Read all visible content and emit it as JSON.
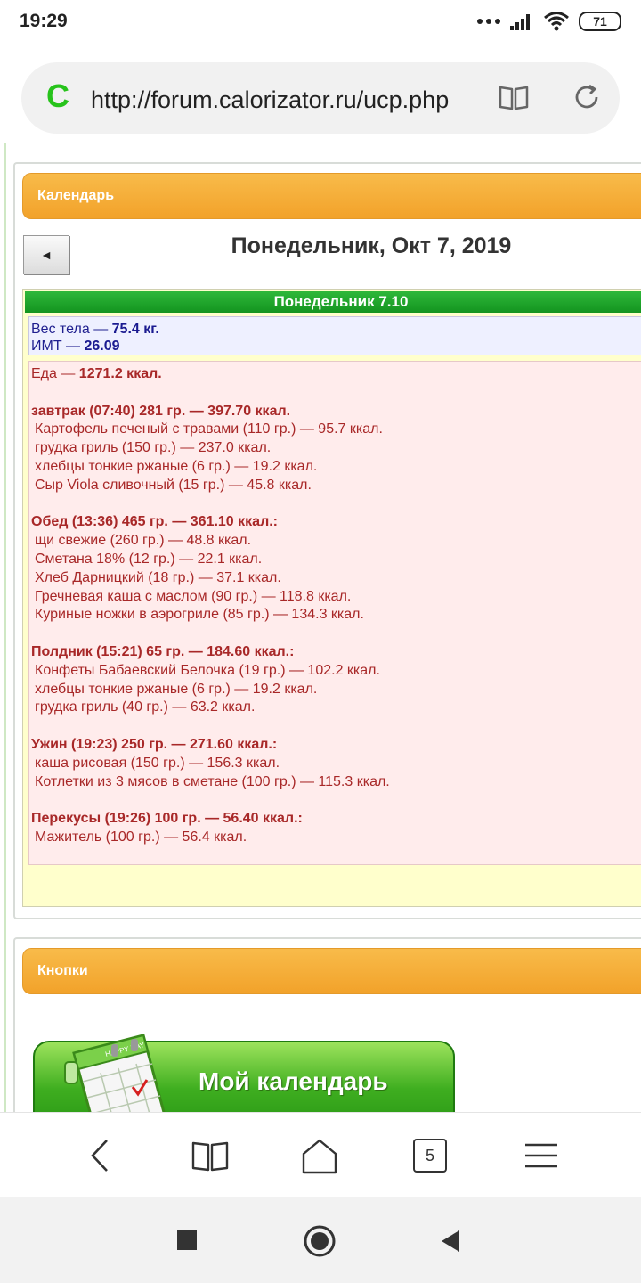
{
  "status": {
    "time": "19:29",
    "battery": "71"
  },
  "browser": {
    "logo": "C",
    "url": "http://forum.calorizator.ru/ucp.php"
  },
  "calendar": {
    "header": "Календарь",
    "prev_label": "◄",
    "date_title": "Понедельник, Окт 7, 2019",
    "day_bar": "Понедельник 7.10",
    "weight_label": "Вес тела — ",
    "weight_value": "75.4 кг.",
    "bmi_label": "ИМТ — ",
    "bmi_value": "26.09",
    "food_label": "Еда — ",
    "food_total": "1271.2 ккал.",
    "meals": [
      {
        "title": "завтрак (07:40) 281 гр. — 397.70 ккал.",
        "items": [
          "Картофель печеный с травами (110 гр.) — 95.7 ккал.",
          "грудка гриль (150 гр.) — 237.0 ккал.",
          "хлебцы тонкие ржаные (6 гр.) — 19.2 ккал.",
          "Сыр Viola сливочный (15 гр.) — 45.8 ккал."
        ]
      },
      {
        "title": "Обед (13:36) 465 гр. — 361.10 ккал.:",
        "items": [
          "щи свежие (260 гр.) — 48.8 ккал.",
          "Сметана 18% (12 гр.) — 22.1 ккал.",
          "Хлеб Дарницкий (18 гр.) — 37.1 ккал.",
          "Гречневая каша с маслом (90 гр.) — 118.8 ккал.",
          "Куриные ножки в аэрогриле (85 гр.) — 134.3 ккал."
        ]
      },
      {
        "title": "Полдник (15:21) 65 гр. — 184.60 ккал.:",
        "items": [
          "Конфеты Бабаевский Белочка (19 гр.) — 102.2 ккал.",
          "хлебцы тонкие ржаные (6 гр.) — 19.2 ккал.",
          "грудка гриль (40 гр.) — 63.2 ккал."
        ]
      },
      {
        "title": "Ужин (19:23) 250 гр. — 271.60 ккал.:",
        "items": [
          "каша рисовая (150 гр.) — 156.3 ккал.",
          "Котлетки из 3 мясов в сметане (100 гр.) — 115.3 ккал."
        ]
      },
      {
        "title": "Перекусы (19:26) 100 гр. — 56.40 ккал.:",
        "items": [
          "Мажитель (100 гр.) — 56.4 ккал."
        ]
      }
    ]
  },
  "buttons_panel": {
    "header": "Кнопки",
    "my_calendar": "Мой календарь",
    "calendar_art_text": "HAPPY DAY"
  },
  "bottom_bar": {
    "tabs_count": "5"
  },
  "colors": {
    "accent_orange": "#f2a22a",
    "green": "#1f9a22",
    "food_text": "#a82828",
    "stats_text": "#1f1f8f"
  }
}
